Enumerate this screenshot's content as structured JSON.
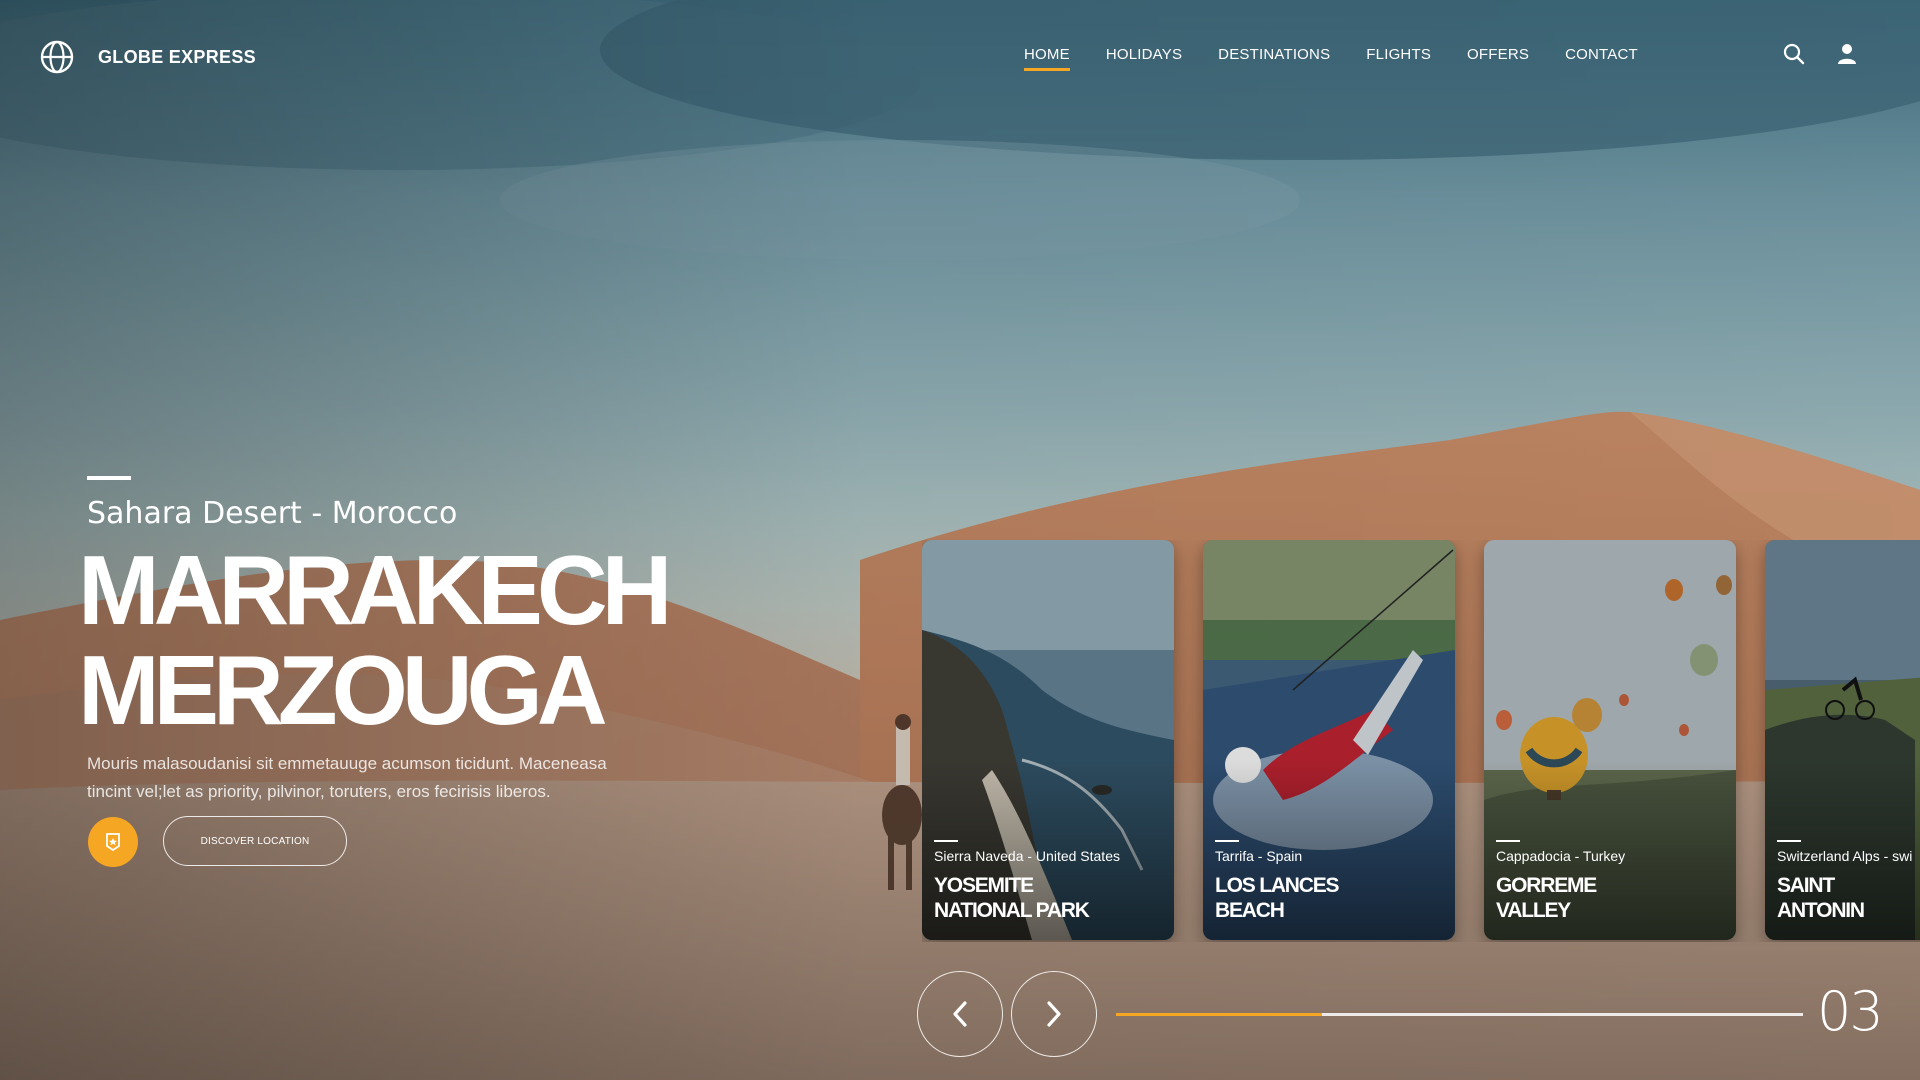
{
  "brand": {
    "name": "GLOBE EXPRESS",
    "logo_icon": "globe-icon"
  },
  "nav": {
    "items": [
      {
        "label": "HOME",
        "active": true
      },
      {
        "label": "HOLIDAYS"
      },
      {
        "label": "DESTINATIONS"
      },
      {
        "label": "FLIGHTS"
      },
      {
        "label": "OFFERS"
      },
      {
        "label": "CONTACT"
      }
    ],
    "icons": [
      "search-icon",
      "user-icon"
    ]
  },
  "hero": {
    "subtitle": "Sahara Desert - Morocco",
    "title_line1": "MARRAKECH",
    "title_line2": "MERZOUGA",
    "description": "Mouris malasoudanisi sit emmetauuge acumson ticidunt. Maceneasa tincint vel;let as priority, pilvinor, toruters, eros fecirisis liberos.",
    "bookmark_icon": "bookmark-icon",
    "discover_label": "DISCOVER LOCATION"
  },
  "cards": [
    {
      "location": "Sierra Naveda - United States",
      "title_line1": "YOSEMITE",
      "title_line2": "NATIONAL PARK"
    },
    {
      "location": "Tarrifa - Spain",
      "title_line1": "LOS LANCES",
      "title_line2": "BEACH"
    },
    {
      "location": "Cappadocia - Turkey",
      "title_line1": "GORREME",
      "title_line2": "VALLEY"
    },
    {
      "location": "Switzerland Alps - swi",
      "title_line1": "SAINT",
      "title_line2": "ANTONIN"
    }
  ],
  "slider": {
    "prev_icon": "chevron-left-icon",
    "next_icon": "chevron-right-icon",
    "progress": 0.3,
    "current": "03"
  },
  "colors": {
    "accent": "#f5a623",
    "text": "#ffffff"
  }
}
